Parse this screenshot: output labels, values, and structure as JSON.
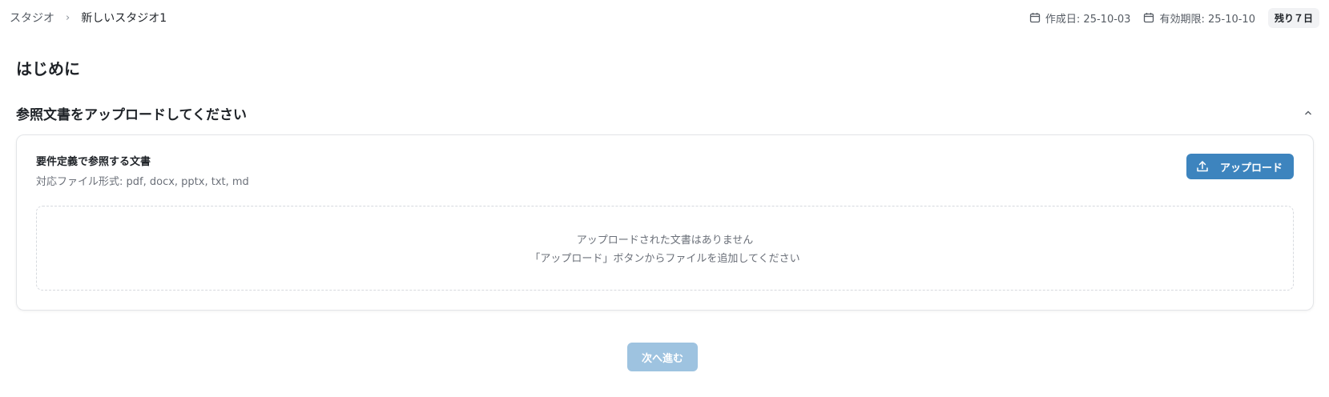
{
  "breadcrumb": {
    "root": "スタジオ",
    "separator": "›",
    "current": "新しいスタジオ1"
  },
  "meta": {
    "created": "作成日: 25-10-03",
    "expires": "有効期限: 25-10-10",
    "remaining_badge": "残り７日"
  },
  "main": {
    "intro_heading": "はじめに",
    "section_title": "参照文書をアップロードしてください",
    "card": {
      "title": "要件定義で参照する文書",
      "supported_formats": "対応ファイル形式: pdf, docx, pptx, txt, md",
      "upload_label": "アップロード",
      "empty_line1": "アップロードされた文書はありません",
      "empty_line2": "「アップロード」ボタンからファイルを追加してください"
    },
    "next_label": "次へ進む"
  },
  "icons": {
    "calendar": "calendar-icon",
    "upload": "upload-icon",
    "collapse": "chevron-up-icon"
  },
  "colors": {
    "primary": "#3d84be",
    "primary_disabled": "#9ec3e0"
  }
}
